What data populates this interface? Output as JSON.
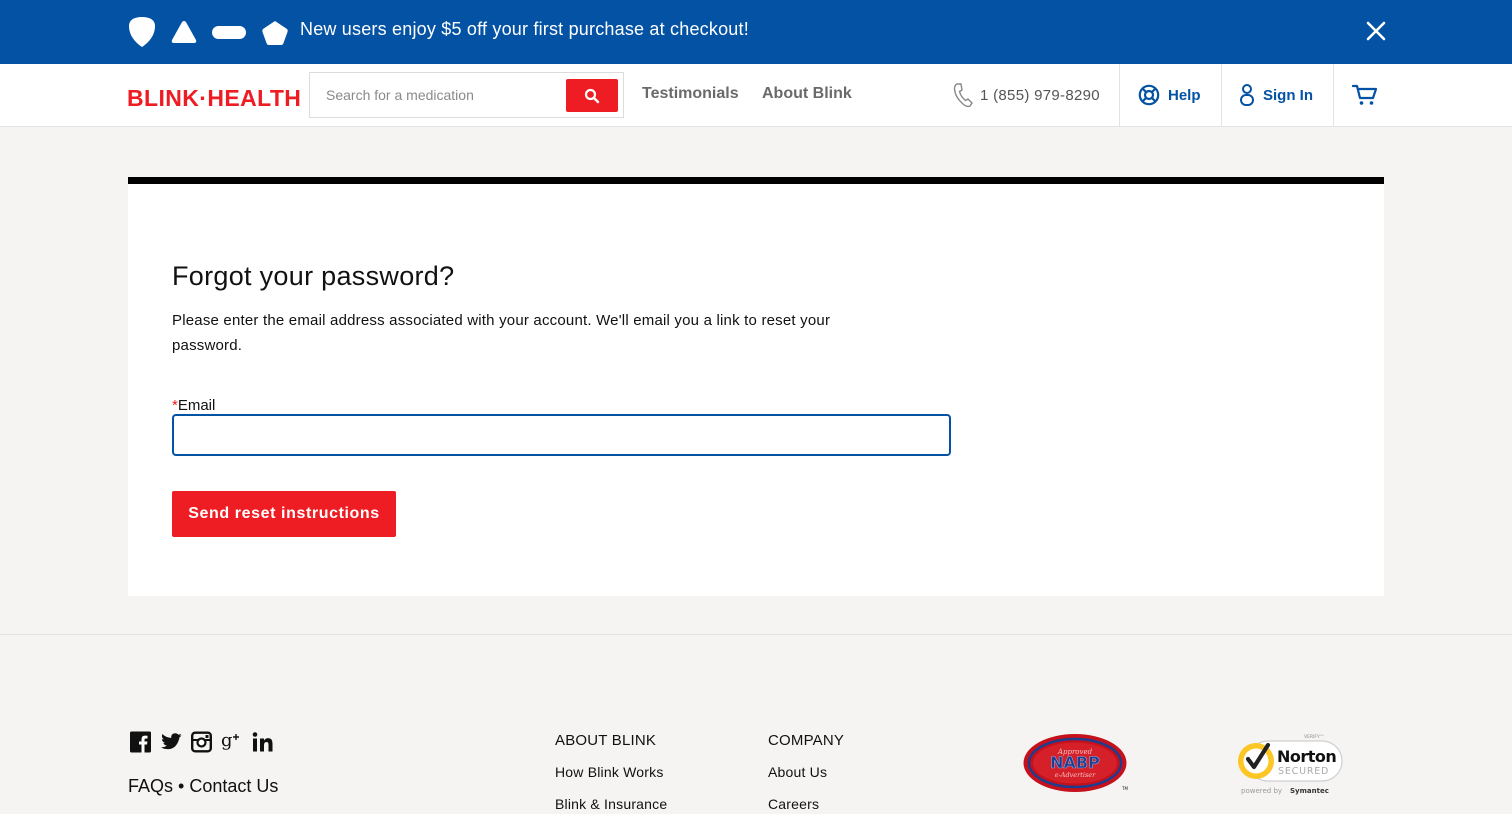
{
  "promo": {
    "text": "New users enjoy $5 off your first purchase at checkout!",
    "icons": [
      "shield-icon",
      "triangle-icon",
      "pill-icon",
      "pentagon-icon"
    ],
    "close_icon": "close-icon"
  },
  "header": {
    "logo_text": "BLINK·HEALTH",
    "search_placeholder": "Search for a medication",
    "search_icon": "search-icon",
    "nav": [
      "Testimonials",
      "About Blink"
    ],
    "phone": "1 (855) 979-8290",
    "help_label": "Help",
    "sign_in_label": "Sign In",
    "cart_icon": "cart-icon"
  },
  "form": {
    "title": "Forgot your password?",
    "description": "Please enter the email address associated with your account. We'll email you a link to reset your password.",
    "required_mark": "*",
    "email_label": "Email",
    "email_value": "",
    "submit_label": "Send reset instructions"
  },
  "footer": {
    "social_icons": [
      "facebook-icon",
      "twitter-icon",
      "instagram-icon",
      "google-plus-icon",
      "linkedin-icon"
    ],
    "faqs_label": "FAQs",
    "separator": "•",
    "contact_label": "Contact Us",
    "about_heading": "ABOUT BLINK",
    "about_items": [
      "How Blink Works",
      "Blink & Insurance"
    ],
    "company_heading": "COMPANY",
    "company_items": [
      "About Us",
      "Careers"
    ],
    "nabp": {
      "top": "Approved",
      "main": "NABP",
      "bottom": "e-Advertiser",
      "tm": "TM"
    },
    "norton": {
      "verify": "VERIFY™",
      "brand": "Norton",
      "secured": "SECURED",
      "powered": "powered by",
      "symantec": "Symantec"
    }
  },
  "colors": {
    "brand_blue": "#0452a4",
    "brand_red": "#ee1d23",
    "page_bg": "#f5f4f2"
  }
}
